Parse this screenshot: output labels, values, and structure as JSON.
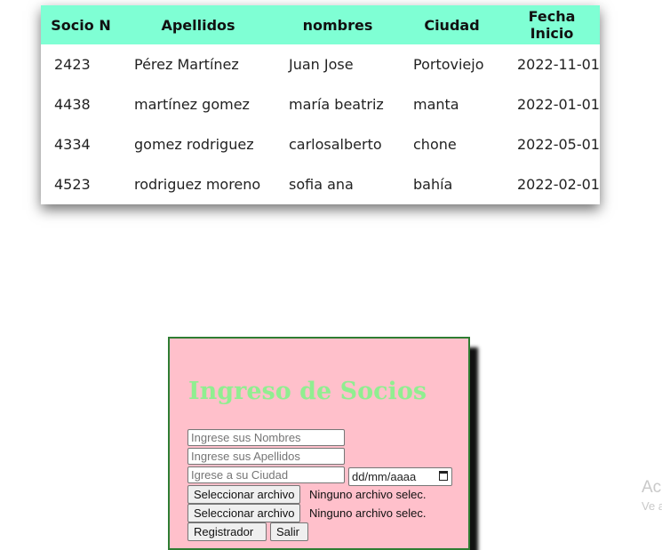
{
  "table": {
    "headers": [
      "Socio N",
      "Apellidos",
      "nombres",
      "Ciudad",
      "Fecha Inicio"
    ],
    "rows": [
      [
        "2423",
        "Pérez Martínez",
        "Juan Jose",
        "Portoviejo",
        "2022-11-01"
      ],
      [
        "4438",
        "martínez gomez",
        "maría beatriz",
        "manta",
        "2022-01-01"
      ],
      [
        "4334",
        "gomez rodriguez",
        "carlosalberto",
        "chone",
        "2022-05-01"
      ],
      [
        "4523",
        "rodriguez moreno",
        "sofia ana",
        "bahía",
        "2022-02-01"
      ]
    ]
  },
  "form": {
    "title": "Ingreso de Socios",
    "nombres_placeholder": "Ingrese sus Nombres",
    "apellidos_placeholder": "Ingrese sus Apellidos",
    "ciudad_placeholder": "Igrese a su Ciudad",
    "date_placeholder": "dd/mm/aaaa",
    "file1_button": "Seleccionar archivo",
    "file1_status": "Ninguno archivo selec.",
    "file2_button": "Seleccionar archivo",
    "file2_status": "Ninguno archivo selec.",
    "register_button": "Registrador",
    "exit_button": "Salir"
  },
  "watermark": {
    "line1": "Ac",
    "line2": "Ve a"
  },
  "colors": {
    "table_header": "#7fffd4",
    "card_background": "#ffc0cb",
    "card_border": "#2e7d32",
    "title_color": "#90ee90"
  }
}
